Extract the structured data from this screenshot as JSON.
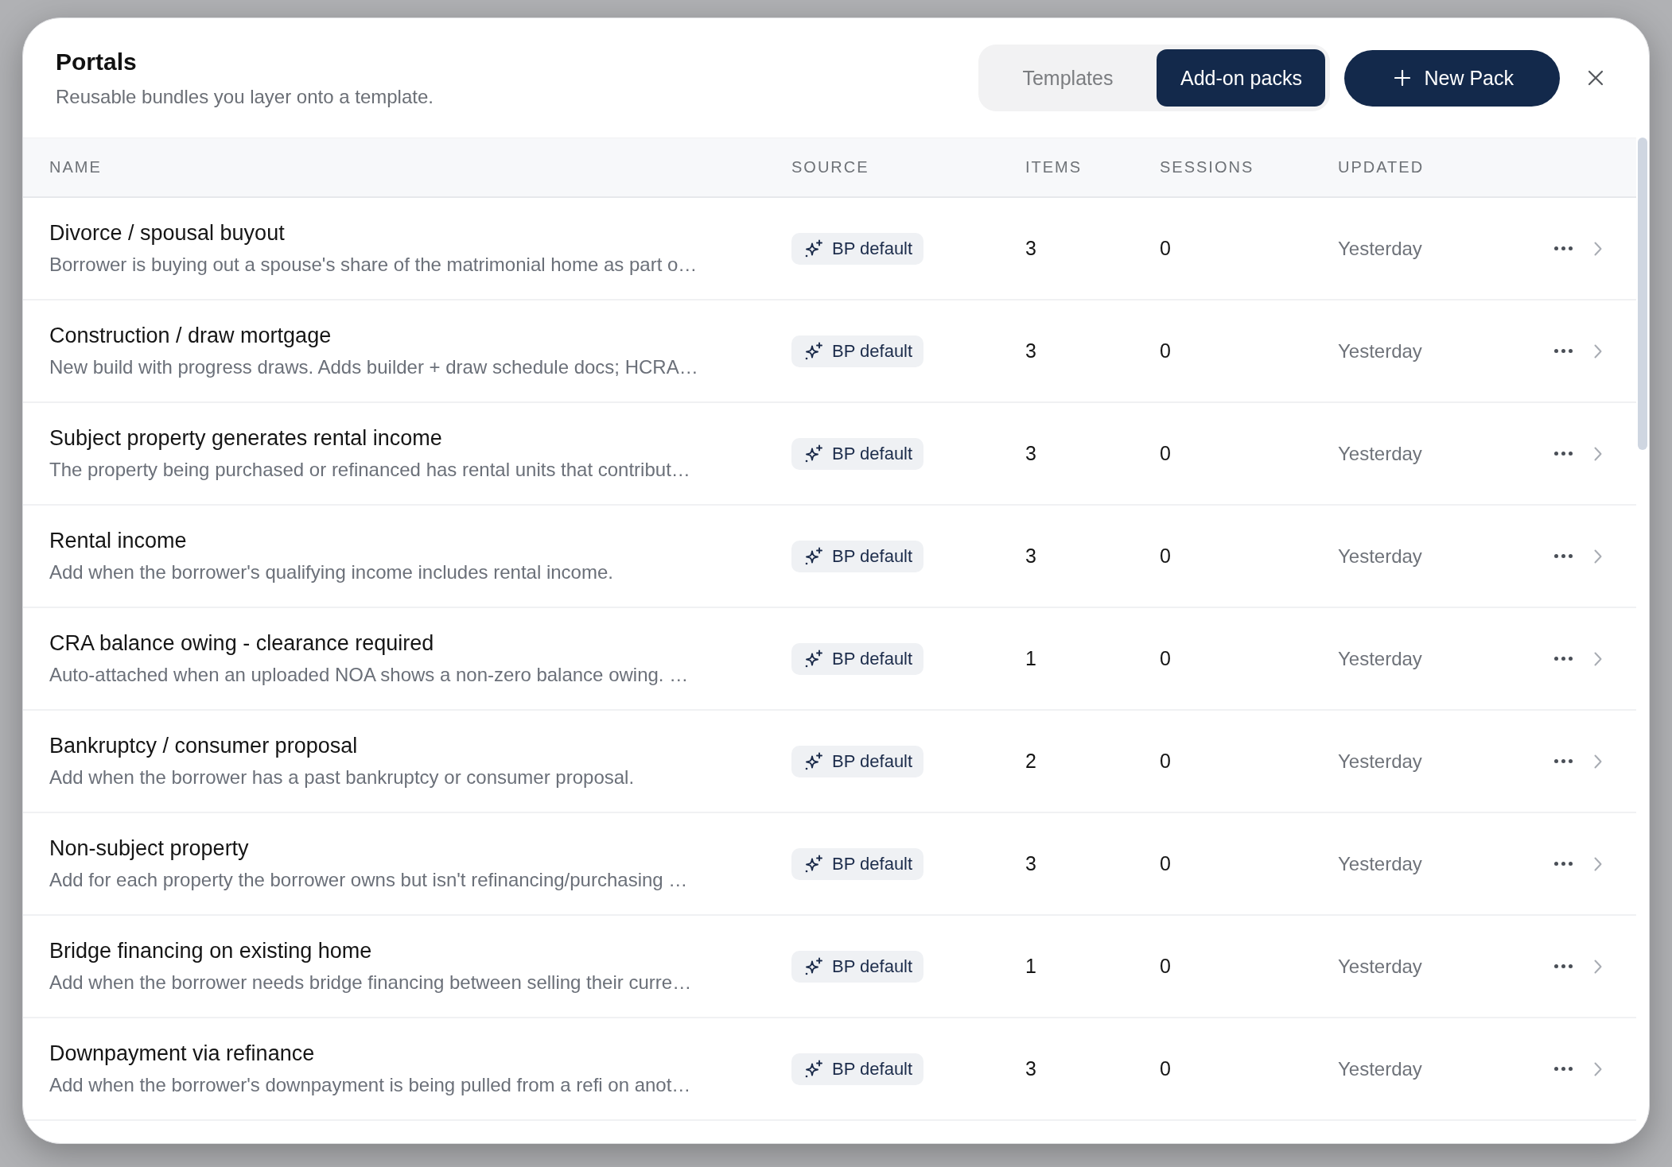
{
  "dialog": {
    "title": "Portals",
    "subtitle": "Reusable bundles you layer onto a template."
  },
  "tabs": [
    {
      "label": "Templates",
      "selected": false
    },
    {
      "label": "Add-on packs",
      "selected": true
    }
  ],
  "new_button": {
    "label": "New Pack"
  },
  "table": {
    "columns": [
      "NAME",
      "SOURCE",
      "ITEMS",
      "SESSIONS",
      "UPDATED"
    ],
    "rows": [
      {
        "name": "Divorce / spousal buyout",
        "description": "Borrower is buying out a spouse's share of the matrimonial home as part o…",
        "source": "BP default",
        "items": "3",
        "sessions": "0",
        "updated": "Yesterday"
      },
      {
        "name": "Construction / draw mortgage",
        "description": "New build with progress draws. Adds builder + draw schedule docs; HCRA…",
        "source": "BP default",
        "items": "3",
        "sessions": "0",
        "updated": "Yesterday"
      },
      {
        "name": "Subject property generates rental income",
        "description": "The property being purchased or refinanced has rental units that contribut…",
        "source": "BP default",
        "items": "3",
        "sessions": "0",
        "updated": "Yesterday"
      },
      {
        "name": "Rental income",
        "description": "Add when the borrower's qualifying income includes rental income.",
        "source": "BP default",
        "items": "3",
        "sessions": "0",
        "updated": "Yesterday"
      },
      {
        "name": "CRA balance owing - clearance required",
        "description": "Auto-attached when an uploaded NOA shows a non-zero balance owing. …",
        "source": "BP default",
        "items": "1",
        "sessions": "0",
        "updated": "Yesterday"
      },
      {
        "name": "Bankruptcy / consumer proposal",
        "description": "Add when the borrower has a past bankruptcy or consumer proposal.",
        "source": "BP default",
        "items": "2",
        "sessions": "0",
        "updated": "Yesterday"
      },
      {
        "name": "Non-subject property",
        "description": "Add for each property the borrower owns but isn't refinancing/purchasing …",
        "source": "BP default",
        "items": "3",
        "sessions": "0",
        "updated": "Yesterday"
      },
      {
        "name": "Bridge financing on existing home",
        "description": "Add when the borrower needs bridge financing between selling their curre…",
        "source": "BP default",
        "items": "1",
        "sessions": "0",
        "updated": "Yesterday"
      },
      {
        "name": "Downpayment via refinance",
        "description": "Add when the borrower's downpayment is being pulled from a refi on anot…",
        "source": "BP default",
        "items": "3",
        "sessions": "0",
        "updated": "Yesterday"
      }
    ]
  }
}
